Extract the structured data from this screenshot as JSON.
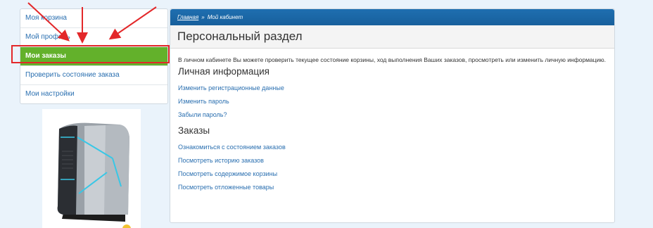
{
  "sidebar": {
    "items": [
      {
        "label": "Моя корзина"
      },
      {
        "label": "Мой профиль"
      },
      {
        "label": "Мои заказы"
      },
      {
        "label": "Проверить состояние заказа"
      },
      {
        "label": "Мои настройки"
      }
    ]
  },
  "breadcrumb": {
    "home": "Главная",
    "separator": "»",
    "current": "Мой кабинет"
  },
  "main": {
    "title": "Персональный раздел",
    "intro": "В личном кабинете Вы можете проверить текущее состояние корзины, ход выполнения Ваших заказов, просмотреть или изменить личную информацию.",
    "personal_heading": "Личная информация",
    "personal_links": [
      "Изменить регистрационные данные",
      "Изменить пароль",
      "Забыли пароль?"
    ],
    "orders_heading": "Заказы",
    "orders_links": [
      "Ознакомиться с состоянием заказов",
      "Посмотреть историю заказов",
      "Посмотреть содержимое корзины",
      "Посмотреть отложенные товары"
    ]
  },
  "colors": {
    "accent_blue": "#1f6fb0",
    "active_green": "#63b12b",
    "annotation_red": "#e3282a",
    "link": "#2a6fb0"
  }
}
